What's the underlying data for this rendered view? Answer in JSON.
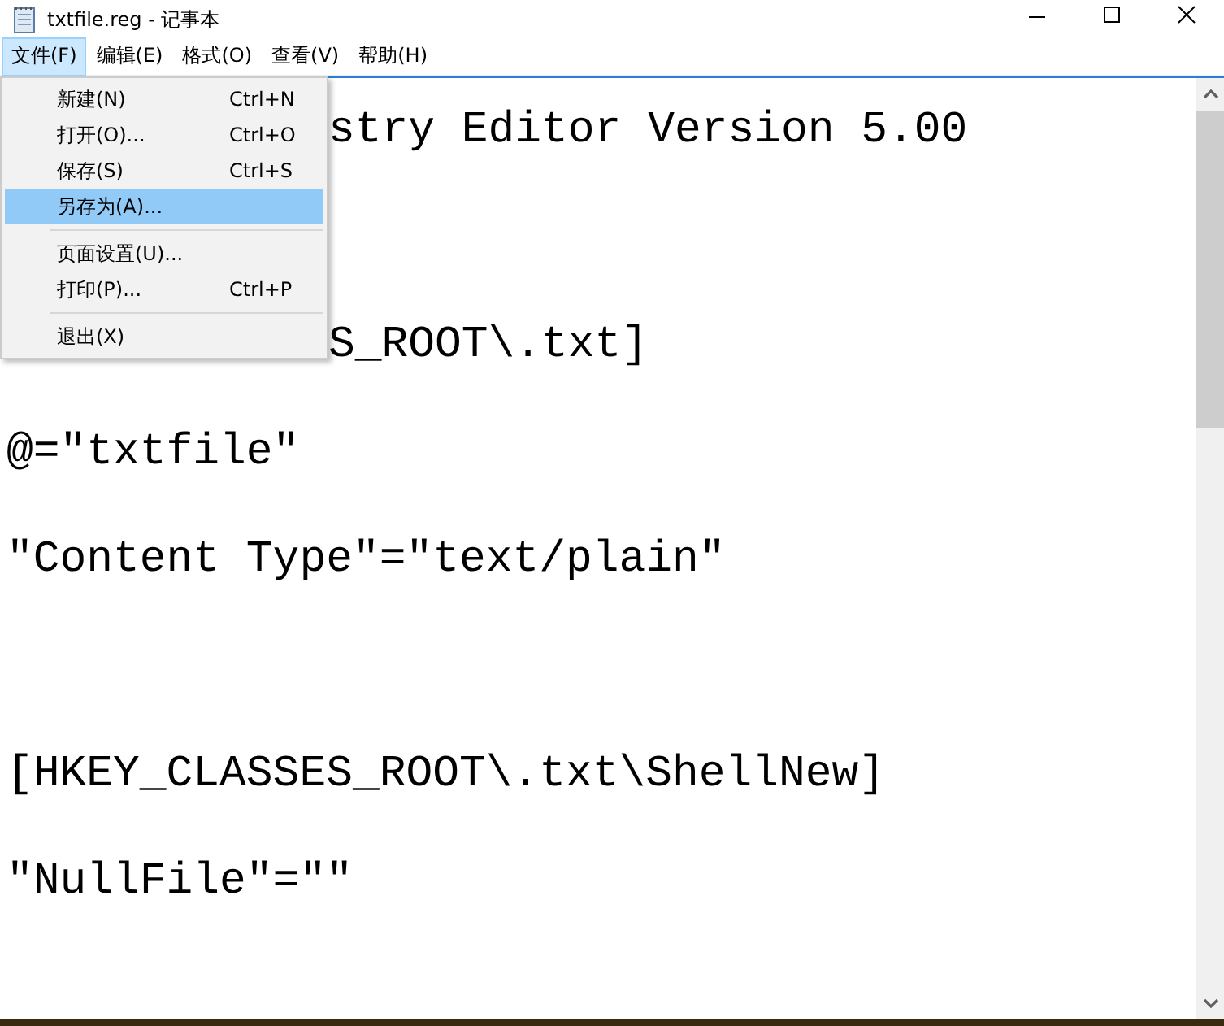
{
  "window": {
    "title": "txtfile.reg - 记事本"
  },
  "menu_bar": [
    {
      "label": "文件(F)",
      "selected": true
    },
    {
      "label": "编辑(E)",
      "selected": false
    },
    {
      "label": "格式(O)",
      "selected": false
    },
    {
      "label": "查看(V)",
      "selected": false
    },
    {
      "label": "帮助(H)",
      "selected": false
    }
  ],
  "file_menu": [
    {
      "kind": "item",
      "label": "新建(N)",
      "shortcut": "Ctrl+N",
      "selected": false
    },
    {
      "kind": "item",
      "label": "打开(O)...",
      "shortcut": "Ctrl+O",
      "selected": false
    },
    {
      "kind": "item",
      "label": "保存(S)",
      "shortcut": "Ctrl+S",
      "selected": false
    },
    {
      "kind": "item",
      "label": "另存为(A)...",
      "selected": true
    },
    {
      "kind": "separator"
    },
    {
      "kind": "item",
      "label": "页面设置(U)...",
      "selected": false
    },
    {
      "kind": "item",
      "label": "打印(P)...",
      "shortcut": "Ctrl+P",
      "selected": false
    },
    {
      "kind": "separator"
    },
    {
      "kind": "item",
      "label": "退出(X)",
      "selected": false
    }
  ],
  "editor": {
    "lines": [
      {
        "kind": "text",
        "text": "stry Editor Version 5.00",
        "covered": true
      },
      {
        "kind": "blank"
      },
      {
        "kind": "text",
        "text": "S_ROOT\\.txt]",
        "covered": true
      },
      {
        "kind": "text",
        "text": "@=\"txtfile\""
      },
      {
        "kind": "text",
        "text": "\"Content Type\"=\"text/plain\""
      },
      {
        "kind": "blank"
      },
      {
        "kind": "text",
        "text": "[HKEY_CLASSES_ROOT\\.txt\\ShellNew]"
      },
      {
        "kind": "text",
        "text": "\"NullFile\"=\"\""
      }
    ]
  }
}
